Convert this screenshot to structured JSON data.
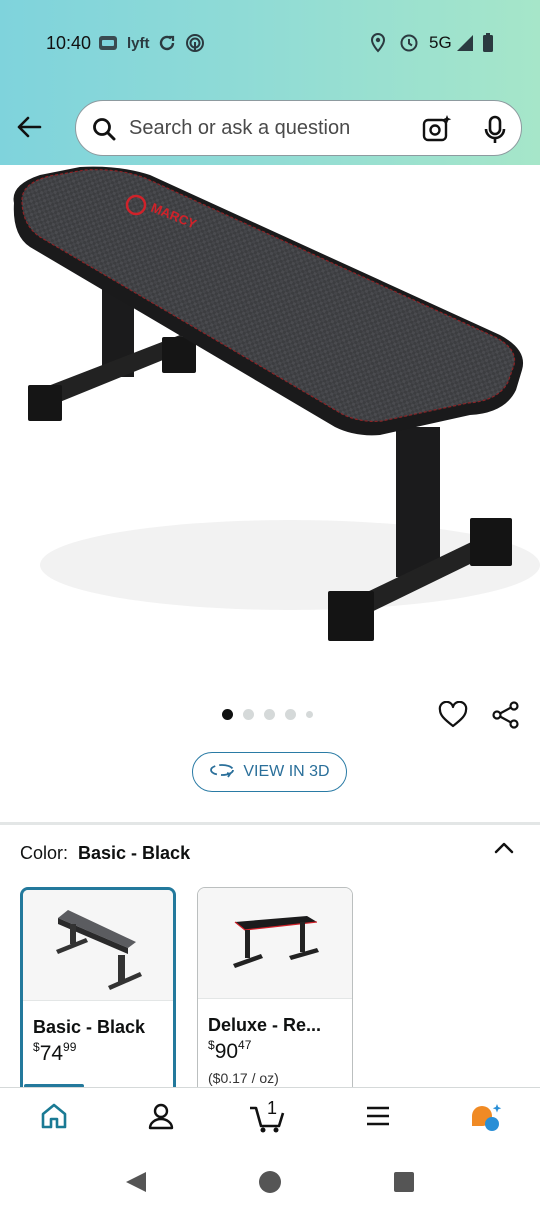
{
  "status_bar": {
    "time": "10:40",
    "network": "5G",
    "icons": [
      "sim-card-icon",
      "lyft-icon",
      "sync-icon",
      "nfc-icon",
      "location-icon",
      "alarm-icon",
      "signal-icon",
      "battery-icon"
    ]
  },
  "header": {
    "search_placeholder": "Search or ask a question",
    "icons": [
      "back-arrow-icon",
      "search-icon",
      "camera-icon",
      "mic-icon"
    ]
  },
  "gallery": {
    "image_count": 5,
    "active_index": 0,
    "brand_mark": "MARCY",
    "view_3d_label": "VIEW IN 3D"
  },
  "variant": {
    "label": "Color:",
    "selected": "Basic - Black",
    "options": [
      {
        "name": "Basic - Black",
        "price_whole": "74",
        "price_fraction": "99",
        "currency": "$",
        "unit_price": "",
        "selected": true
      },
      {
        "name": "Deluxe - Re...",
        "price_whole": "90",
        "price_fraction": "47",
        "currency": "$",
        "unit_price": "($0.17 / oz)",
        "selected": false
      }
    ]
  },
  "bottom_nav": [
    "home-icon",
    "account-icon",
    "cart-icon",
    "menu-icon",
    "rufus-icon"
  ],
  "cart_count": "1",
  "colors": {
    "accent": "#23799c",
    "topbar": "#8fdbd6",
    "brand_red": "#d0222a"
  }
}
